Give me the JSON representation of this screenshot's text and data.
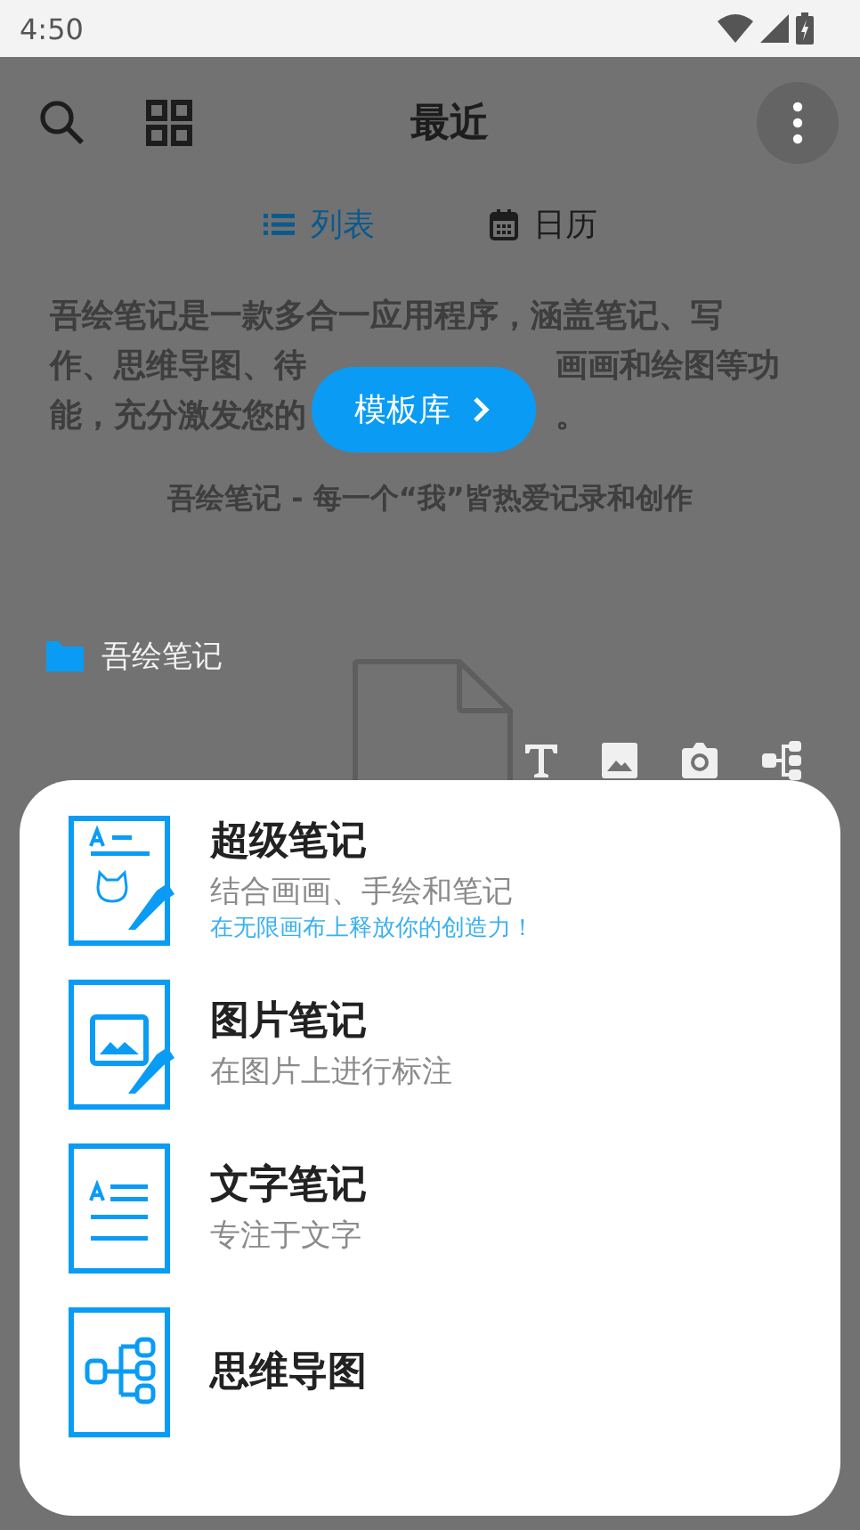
{
  "status_bar": {
    "time": "4:50"
  },
  "header": {
    "title": "最近"
  },
  "tabs": [
    {
      "label": "列表",
      "selected": true,
      "kind": "list"
    },
    {
      "label": "日历",
      "selected": false,
      "kind": "calendar"
    }
  ],
  "intro": {
    "description_lines": [
      {
        "segments": [
          "吾绘笔记是一款多合一应用程序，涵盖笔记、写"
        ]
      },
      {
        "segments": [
          "作、思维导图、待",
          "画画和绘图等功"
        ]
      },
      {
        "segments": [
          "能，充分激发您的",
          "。"
        ]
      }
    ],
    "slogan": "吾绘笔记 - 每一个“我”皆热爱记录和创作",
    "template_button": "模板库"
  },
  "folder": {
    "name": "吾绘笔记"
  },
  "sheet": {
    "items": [
      {
        "kind": "super",
        "title": "超级笔记",
        "subtitle": "结合画画、手绘和笔记",
        "tagline": "在无限画布上释放你的创造力！"
      },
      {
        "kind": "image",
        "title": "图片笔记",
        "subtitle": "在图片上进行标注"
      },
      {
        "kind": "text",
        "title": "文字笔记",
        "subtitle": "专注于文字"
      },
      {
        "kind": "mindmap",
        "title": "思维导图"
      }
    ]
  }
}
